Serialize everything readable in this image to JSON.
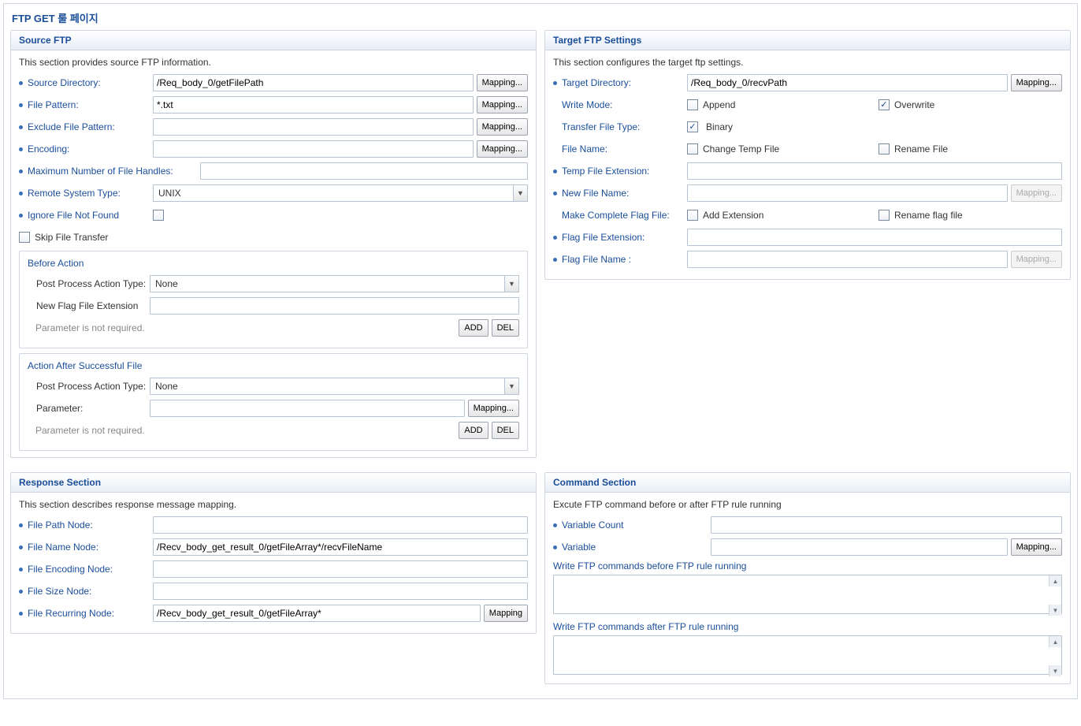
{
  "pageTitle": "FTP GET 룰 페이지",
  "buttons": {
    "mapping": "Mapping...",
    "mappingShort": "Mapping",
    "add": "ADD",
    "del": "DEL"
  },
  "source": {
    "title": "Source FTP",
    "desc": "This section provides source FTP information.",
    "fields": {
      "sourceDirectory": {
        "label": "Source Directory:",
        "value": "/Req_body_0/getFilePath"
      },
      "filePattern": {
        "label": "File Pattern:",
        "value": "*.txt"
      },
      "excludeFilePattern": {
        "label": "Exclude File Pattern:",
        "value": ""
      },
      "encoding": {
        "label": "Encoding:",
        "value": ""
      },
      "maxHandles": {
        "label": "Maximum Number of File Handles:",
        "value": ""
      },
      "remoteSystemType": {
        "label": "Remote System Type:",
        "value": "UNIX"
      },
      "ignoreNotFound": {
        "label": "Ignore File Not Found",
        "checked": false
      },
      "skipFileTransfer": {
        "label": "Skip File Transfer",
        "checked": false
      }
    },
    "before": {
      "title": "Before Action",
      "postProcessLabel": "Post Process Action Type:",
      "postProcessValue": "None",
      "newFlagExtLabel": "New Flag File Extension",
      "newFlagExtValue": "",
      "paramNote": "Parameter is not required."
    },
    "after": {
      "title": "Action After Successful File",
      "postProcessLabel": "Post Process Action Type:",
      "postProcessValue": "None",
      "parameterLabel": "Parameter:",
      "parameterValue": "",
      "paramNote": "Parameter is not required."
    }
  },
  "target": {
    "title": "Target FTP Settings",
    "desc": "This section configures the target ftp settings.",
    "fields": {
      "targetDirectory": {
        "label": "Target Directory:",
        "value": "/Req_body_0/recvPath"
      },
      "writeMode": {
        "label": "Write Mode:",
        "append": "Append",
        "appendChecked": false,
        "overwrite": "Overwrite",
        "overwriteChecked": true
      },
      "transferType": {
        "label": "Transfer File Type:",
        "binary": "Binary",
        "binaryChecked": true
      },
      "fileName": {
        "label": "File Name:",
        "changeTemp": "Change Temp File",
        "changeTempChecked": false,
        "rename": "Rename File",
        "renameChecked": false
      },
      "tempExt": {
        "label": "Temp File Extension:",
        "value": ""
      },
      "newFileName": {
        "label": "New File Name:",
        "value": ""
      },
      "makeFlag": {
        "label": "Make Complete Flag File:",
        "addExt": "Add Extension",
        "addExtChecked": false,
        "renameFlag": "Rename flag file",
        "renameFlagChecked": false
      },
      "flagExt": {
        "label": "Flag File Extension:",
        "value": ""
      },
      "flagName": {
        "label": "Flag File Name :",
        "value": ""
      }
    }
  },
  "response": {
    "title": "Response Section",
    "desc": "This section describes response message mapping.",
    "fields": {
      "filePathNode": {
        "label": "File Path Node:",
        "value": ""
      },
      "fileNameNode": {
        "label": "File Name Node:",
        "value": "/Recv_body_get_result_0/getFileArray*/recvFileName"
      },
      "fileEncodingNode": {
        "label": "File Encoding Node:",
        "value": ""
      },
      "fileSizeNode": {
        "label": "File Size Node:",
        "value": ""
      },
      "fileRecurringNode": {
        "label": "File Recurring Node:",
        "value": "/Recv_body_get_result_0/getFileArray*"
      }
    }
  },
  "command": {
    "title": "Command Section",
    "desc": "Excute FTP command before or after FTP rule running",
    "variableCountLabel": "Variable Count",
    "variableCountValue": "",
    "variableLabel": "Variable",
    "variableValue": "",
    "beforeLabel": "Write FTP commands before FTP rule running",
    "afterLabel": "Write FTP commands after FTP rule running"
  }
}
